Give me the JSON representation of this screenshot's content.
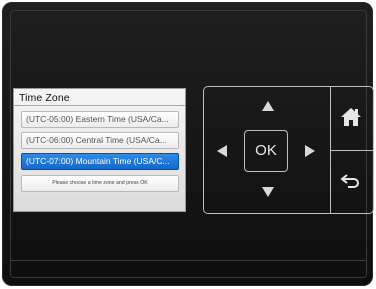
{
  "time_zone_dialog": {
    "title": "Time Zone",
    "items": [
      {
        "label": "(UTC-05:00) Eastern Time (USA/Ca...",
        "selected": false
      },
      {
        "label": "(UTC-06:00) Central Time (USA/Ca...",
        "selected": false
      },
      {
        "label": "(UTC-07:00) Mountain Time (USA/C...",
        "selected": true
      }
    ],
    "hint": "Please choose a time zone and press OK"
  },
  "dpad": {
    "ok_label": "OK"
  },
  "icons": {
    "up": "arrow-up-icon",
    "down": "arrow-down-icon",
    "left": "arrow-left-icon",
    "right": "arrow-right-icon",
    "home": "home-icon",
    "back": "back-icon"
  },
  "colors": {
    "selected": "#1f78d8",
    "panel_bg": "#141414",
    "outline": "#bfbfbf"
  }
}
